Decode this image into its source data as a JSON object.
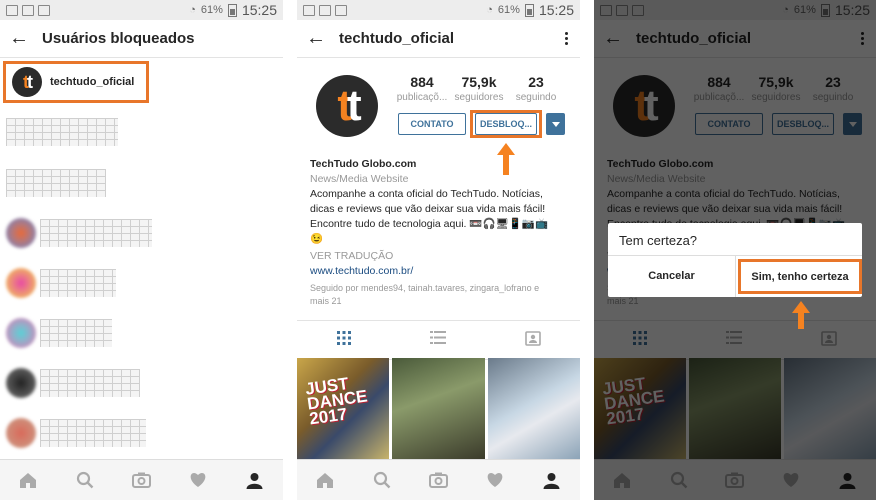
{
  "status_bar": {
    "battery": "61%",
    "time": "15:25"
  },
  "panel1": {
    "title": "Usuários bloqueados",
    "highlighted_user": "techtudo_oficial"
  },
  "profile": {
    "username": "techtudo_oficial",
    "logo_text": "tt",
    "stats": [
      {
        "num": "884",
        "label": "publicaçõ..."
      },
      {
        "num": "75,9k",
        "label": "seguidores"
      },
      {
        "num": "23",
        "label": "seguindo"
      }
    ],
    "contact_label": "CONTATO",
    "unblock_label": "DESBLOQ...",
    "name": "TechTudo Globo.com",
    "category": "News/Media Website",
    "bio_line1": "Acompanhe a conta oficial do TechTudo. Notícias,",
    "bio_line2": "dicas e reviews que vão deixar sua vida mais fácil!",
    "bio_line3": "Encontre tudo de tecnologia aqui. 📼🎧🖥📱📷📺",
    "bio_line4": "😉",
    "translate": "VER TRADUÇÃO",
    "url": "www.techtudo.com.br/",
    "followed_by_1": "Seguido por mendes94, tainah.tavares, zingara_lofrano e",
    "followed_by_2": "mais 21",
    "photo1_text": "JUST DANCE 2017"
  },
  "dialog": {
    "title": "Tem certeza?",
    "cancel": "Cancelar",
    "confirm": "Sim, tenho certeza"
  },
  "colors": {
    "accent_orange": "#e8762a",
    "ig_blue": "#3f729b"
  },
  "icons": [
    "back-arrow-icon",
    "more-options-icon",
    "home-icon",
    "search-icon",
    "camera-icon",
    "heart-icon",
    "profile-icon",
    "grid-icon",
    "list-icon",
    "tagged-icon",
    "dropdown-arrow-icon"
  ]
}
